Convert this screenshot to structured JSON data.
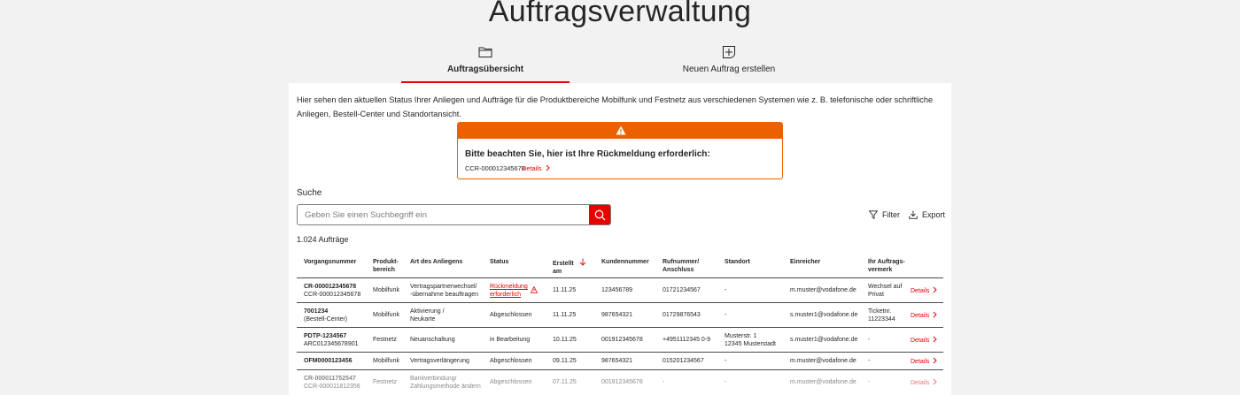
{
  "page": {
    "title": "Auftragsverwaltung"
  },
  "tabs": [
    {
      "label": "Auftragsübersicht",
      "icon": "folder-icon",
      "active": true
    },
    {
      "label": "Neuen Auftrag erstellen",
      "icon": "add-document-icon",
      "active": false
    }
  ],
  "intro": "Hier sehen den aktuellen Status Ihrer Anliegen und Aufträge für die Produktbereiche Mobilfunk und Festnetz aus verschiedenen Systemen wie z. B. telefonische oder schriftliche Anliegen, Bestell-Center und Standortansicht.",
  "alert": {
    "title": "Bitte beachten Sie, hier ist Ihre Rückmeldung erforderlich:",
    "reference": "CCR-000012345678",
    "link_label": "Details",
    "color": "#eb6100"
  },
  "search": {
    "label": "Suche",
    "placeholder": "Geben Sie einen Suchbegriff ein",
    "value": ""
  },
  "toolbar": {
    "filter_label": "Filter",
    "export_label": "Export"
  },
  "results": {
    "count_label": "1.024 Aufträge"
  },
  "table": {
    "headers": {
      "vorgang": "Vorgangsnummer",
      "produkt_1": "Produkt-",
      "produkt_2": "bereich",
      "art": "Art des Anliegens",
      "status": "Status",
      "erstellt_1": "Erstellt",
      "erstellt_2": "am",
      "kunde": "Kundennummer",
      "rufnummer_1": "Rufnummer/",
      "rufnummer_2": "Anschluss",
      "standort": "Standort",
      "einreicher": "Einreicher",
      "vermerk_1": "Ihr Auftrags-",
      "vermerk_2": "vermerk"
    },
    "details_label": "Details",
    "rows": [
      {
        "id": "CR-000012345678",
        "id2": "CCR-000012345678",
        "produkt": "Mobilfunk",
        "art1": "Vertragspartnerwechsel/",
        "art2": "-übernahme beauftragen",
        "status1": "Rückmeldung",
        "status2": "erforderlich",
        "erstellt": "11.11.25",
        "kunde": "123456789",
        "rufnummer": "01721234567",
        "standort1": "-",
        "standort2": "",
        "einreicher": "m.muster@vodafone.de",
        "vermerk1": "Wechsel auf",
        "vermerk2": "Privat"
      },
      {
        "id": "7001234",
        "id2": "(Bestell-Center)",
        "produkt": "Mobilfunk",
        "art1": "Aktivierung /",
        "art2": "Neukarte",
        "status1": "Abgeschlossen",
        "status2": "",
        "erstellt": "11.11.25",
        "kunde": "987654321",
        "rufnummer": "01729876543",
        "standort1": "-",
        "standort2": "",
        "einreicher": "s.muster1@vodafone.de",
        "vermerk1": "Ticketnr.",
        "vermerk2": "11223344"
      },
      {
        "id": "PDTP-1234567",
        "id2": "ARC012345678901",
        "produkt": "Festnetz",
        "art1": "Neuanschaltung",
        "art2": "",
        "status1": "in Bearbeitung",
        "status2": "",
        "erstellt": "10.11.25",
        "kunde": "001912345678",
        "rufnummer": "+4951112345 0-9",
        "standort1": "Musterstr. 1",
        "standort2": "12345 Musterstadt",
        "einreicher": "s.muster1@vodafone.de",
        "vermerk1": "-",
        "vermerk2": ""
      },
      {
        "id": "OFM0000123456",
        "id2": "",
        "produkt": "Mobilfunk",
        "art1": "Vertragsverlängerung",
        "art2": "",
        "status1": "Abgeschlossen",
        "status2": "",
        "erstellt": "09.11.25",
        "kunde": "987654321",
        "rufnummer": "015201234567",
        "standort1": "-",
        "standort2": "",
        "einreicher": "m.muster@vodafone.de",
        "vermerk1": "-",
        "vermerk2": ""
      },
      {
        "id": "CR-000011752547",
        "id2": "CCR-000011812356",
        "produkt": "Festnetz",
        "art1": "Bankverbindung/",
        "art2": "Zahlungsmethode ändern",
        "status1": "Abgeschlossen",
        "status2": "",
        "erstellt": "07.11.25",
        "kunde": "001912345678",
        "rufnummer": "-",
        "standort1": "-",
        "standort2": "",
        "einreicher": "m.muster@vodafone.de",
        "vermerk1": "-",
        "vermerk2": ""
      }
    ]
  },
  "colors": {
    "brand_red": "#e60000",
    "warning_orange": "#eb6100",
    "background": "#f2f2f2"
  }
}
